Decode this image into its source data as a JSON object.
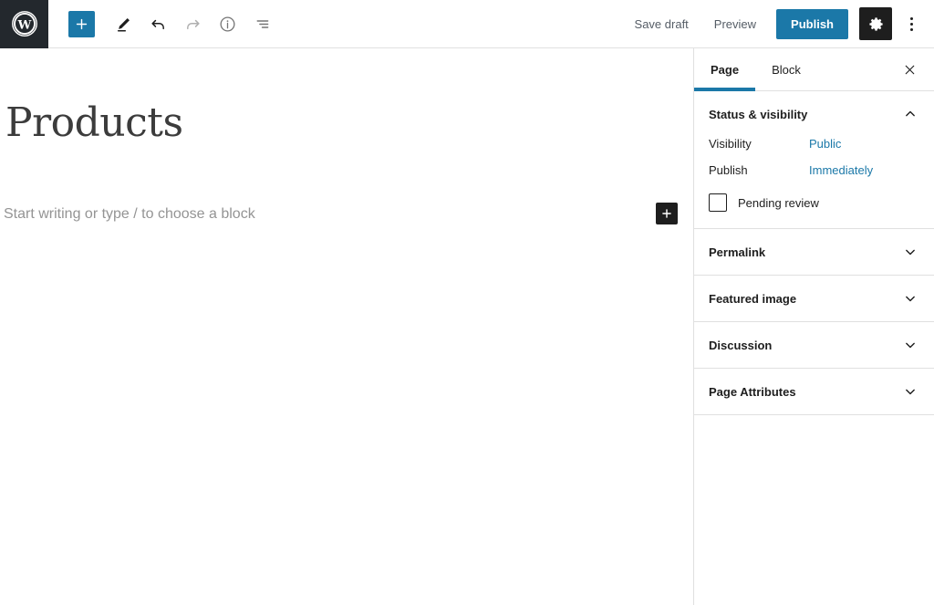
{
  "header": {
    "logo_icon": "wordpress-logo-icon",
    "left_tools": [
      {
        "name": "add-block-button",
        "icon": "plus-icon",
        "label": "Add block",
        "state": "primary"
      },
      {
        "name": "tools-button",
        "icon": "pencil-icon",
        "label": "Tools",
        "state": "active"
      },
      {
        "name": "undo-button",
        "icon": "undo-icon",
        "label": "Undo",
        "state": "enabled"
      },
      {
        "name": "redo-button",
        "icon": "redo-icon",
        "label": "Redo",
        "state": "disabled"
      },
      {
        "name": "details-button",
        "icon": "info-icon",
        "label": "Details",
        "state": "enabled"
      },
      {
        "name": "list-view-button",
        "icon": "list-view-icon",
        "label": "List view",
        "state": "enabled"
      }
    ],
    "save_draft_label": "Save draft",
    "preview_label": "Preview",
    "publish_label": "Publish",
    "settings_icon": "gear-icon",
    "more_menu_icon": "more-vertical-icon"
  },
  "editor": {
    "title": "Products",
    "block_placeholder": "Start writing or type / to choose a block",
    "inline_inserter_icon": "plus-icon"
  },
  "sidebar": {
    "tabs": [
      {
        "label": "Page",
        "active": true
      },
      {
        "label": "Block",
        "active": false
      }
    ],
    "close_icon": "close-icon",
    "panels": [
      {
        "title": "Status & visibility",
        "expanded": true,
        "chevron": "chevron-up-icon",
        "rows": [
          {
            "label": "Visibility",
            "value": "Public"
          },
          {
            "label": "Publish",
            "value": "Immediately"
          }
        ],
        "checkbox": {
          "label": "Pending review",
          "checked": false
        }
      },
      {
        "title": "Permalink",
        "expanded": false,
        "chevron": "chevron-down-icon"
      },
      {
        "title": "Featured image",
        "expanded": false,
        "chevron": "chevron-down-icon"
      },
      {
        "title": "Discussion",
        "expanded": false,
        "chevron": "chevron-down-icon"
      },
      {
        "title": "Page Attributes",
        "expanded": false,
        "chevron": "chevron-down-icon"
      }
    ]
  },
  "colors": {
    "accent_blue": "#1b78a8",
    "link_blue": "#1b78a8",
    "header_dark": "#23282d",
    "button_dark": "#1e1e1e",
    "border": "#e0e0e0",
    "text": "#1e1e1e",
    "muted_text": "#949494"
  }
}
